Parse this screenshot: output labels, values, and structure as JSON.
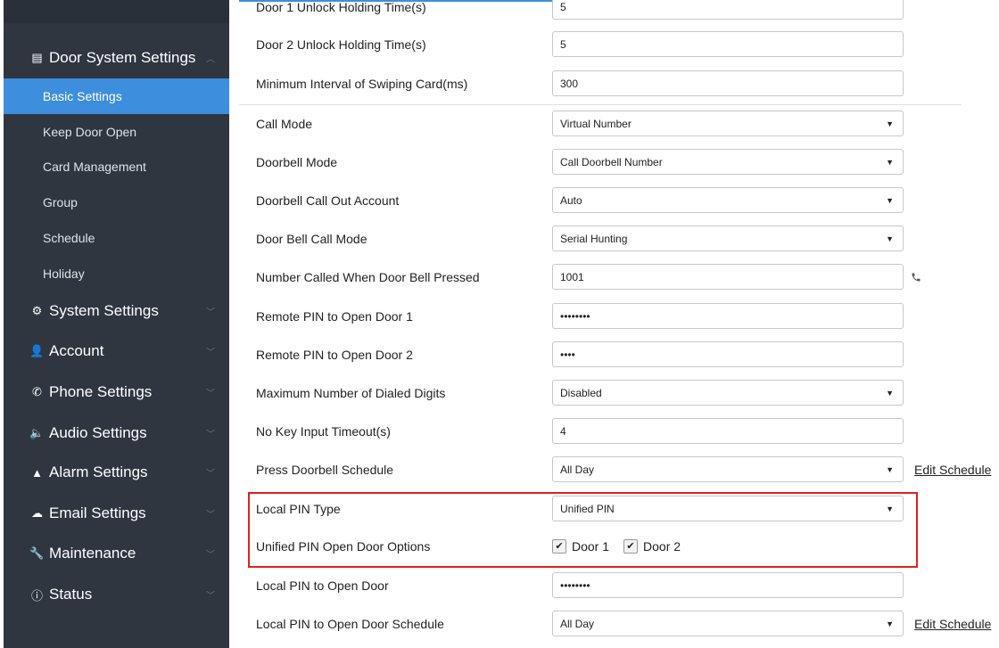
{
  "sidebar": {
    "sections": [
      {
        "label": "Door System Settings",
        "icon": "list-icon"
      },
      {
        "label": "System Settings",
        "icon": "gears-icon"
      },
      {
        "label": "Account",
        "icon": "user-icon"
      },
      {
        "label": "Phone Settings",
        "icon": "phone-icon"
      },
      {
        "label": "Audio Settings",
        "icon": "speaker-icon"
      },
      {
        "label": "Alarm Settings",
        "icon": "warning-icon"
      },
      {
        "label": "Email Settings",
        "icon": "cloud-upload-icon"
      },
      {
        "label": "Maintenance",
        "icon": "wrench-icon"
      },
      {
        "label": "Status",
        "icon": "info-icon"
      }
    ],
    "door_items": [
      "Basic Settings",
      "Keep Door Open",
      "Card Management",
      "Group",
      "Schedule",
      "Holiday"
    ],
    "active_item": "Basic Settings"
  },
  "form": {
    "rows": [
      {
        "label": "Door 1 Unlock Holding Time(s)",
        "value": "5"
      },
      {
        "label": "Door 2 Unlock Holding Time(s)",
        "value": "5"
      },
      {
        "label": "Minimum Interval of Swiping Card(ms)",
        "value": "300"
      },
      {
        "label": "Call Mode",
        "value": "Virtual Number"
      },
      {
        "label": "Doorbell Mode",
        "value": "Call Doorbell Number"
      },
      {
        "label": "Doorbell Call Out Account",
        "value": "Auto"
      },
      {
        "label": "Door Bell Call Mode",
        "value": "Serial Hunting"
      },
      {
        "label": "Number Called When Door Bell Pressed",
        "value": "1001"
      },
      {
        "label": "Remote PIN to Open Door 1",
        "value": "••••••••"
      },
      {
        "label": "Remote PIN to Open Door 2",
        "value": "••••"
      },
      {
        "label": "Maximum Number of Dialed Digits",
        "value": "Disabled"
      },
      {
        "label": "No Key Input Timeout(s)",
        "value": "4"
      },
      {
        "label": "Press Doorbell Schedule",
        "value": "All Day",
        "link": "Edit Schedule"
      },
      {
        "label": "Local PIN Type",
        "value": "Unified PIN"
      },
      {
        "label": "Unified PIN Open Door Options",
        "options": [
          {
            "label": "Door 1",
            "checked": true
          },
          {
            "label": "Door 2",
            "checked": true
          }
        ]
      },
      {
        "label": "Local PIN to Open Door",
        "value": "••••••••"
      },
      {
        "label": "Local PIN to Open Door Schedule",
        "value": "All Day",
        "link": "Edit Schedule"
      }
    ]
  },
  "icons": {
    "caret": "caret-down-icon",
    "chevron": "chevron-icon",
    "phone": "phone-icon",
    "check": "check-icon"
  },
  "colors": {
    "sidebar_bg": "#2f3640",
    "active_bg": "#3e8ede",
    "highlight_border": "#e02020",
    "accent": "#3e8ede"
  }
}
